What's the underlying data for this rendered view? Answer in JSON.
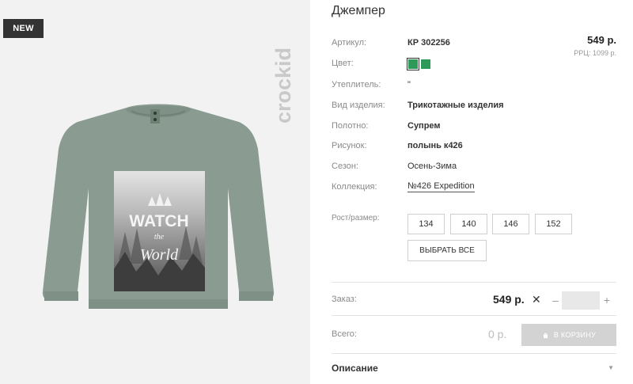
{
  "image_panel": {
    "badge": "NEW",
    "brand": "crockid",
    "print": {
      "line1": "WATCH",
      "line2": "the",
      "line3": "World"
    }
  },
  "product": {
    "title": "Джемпер",
    "attributes": [
      {
        "label": "Артикул:",
        "value": "КР 302256"
      },
      {
        "label": "Цвет:",
        "value": ""
      },
      {
        "label": "Утеплитель:",
        "value": "\""
      },
      {
        "label": "Вид изделия:",
        "value": "Трикотажные изделия"
      },
      {
        "label": "Полотно:",
        "value": "Супрем"
      },
      {
        "label": "Рисунок:",
        "value": "полынь к426"
      },
      {
        "label": "Сезон:",
        "value": "Осень-Зима"
      },
      {
        "label": "Коллекция:",
        "value": "№426 Expedition"
      }
    ],
    "price": "549 р.",
    "rrp": "РРЦ: 1099 р.",
    "colors": [
      "#2e9a59",
      "#2e9a59"
    ]
  },
  "sizes": {
    "label": "Рост/размер:",
    "options": [
      "134",
      "140",
      "146",
      "152"
    ],
    "select_all": "ВЫБРАТЬ ВСЕ"
  },
  "order": {
    "label": "Заказ:",
    "price": "549 р.",
    "times": "✕",
    "minus": "–",
    "plus": "+",
    "quantity": ""
  },
  "total": {
    "label": "Всего:",
    "value": "0 р.",
    "cart_button": "В КОРЗИНУ"
  },
  "description": {
    "title": "Описание",
    "chevron": "▼"
  }
}
